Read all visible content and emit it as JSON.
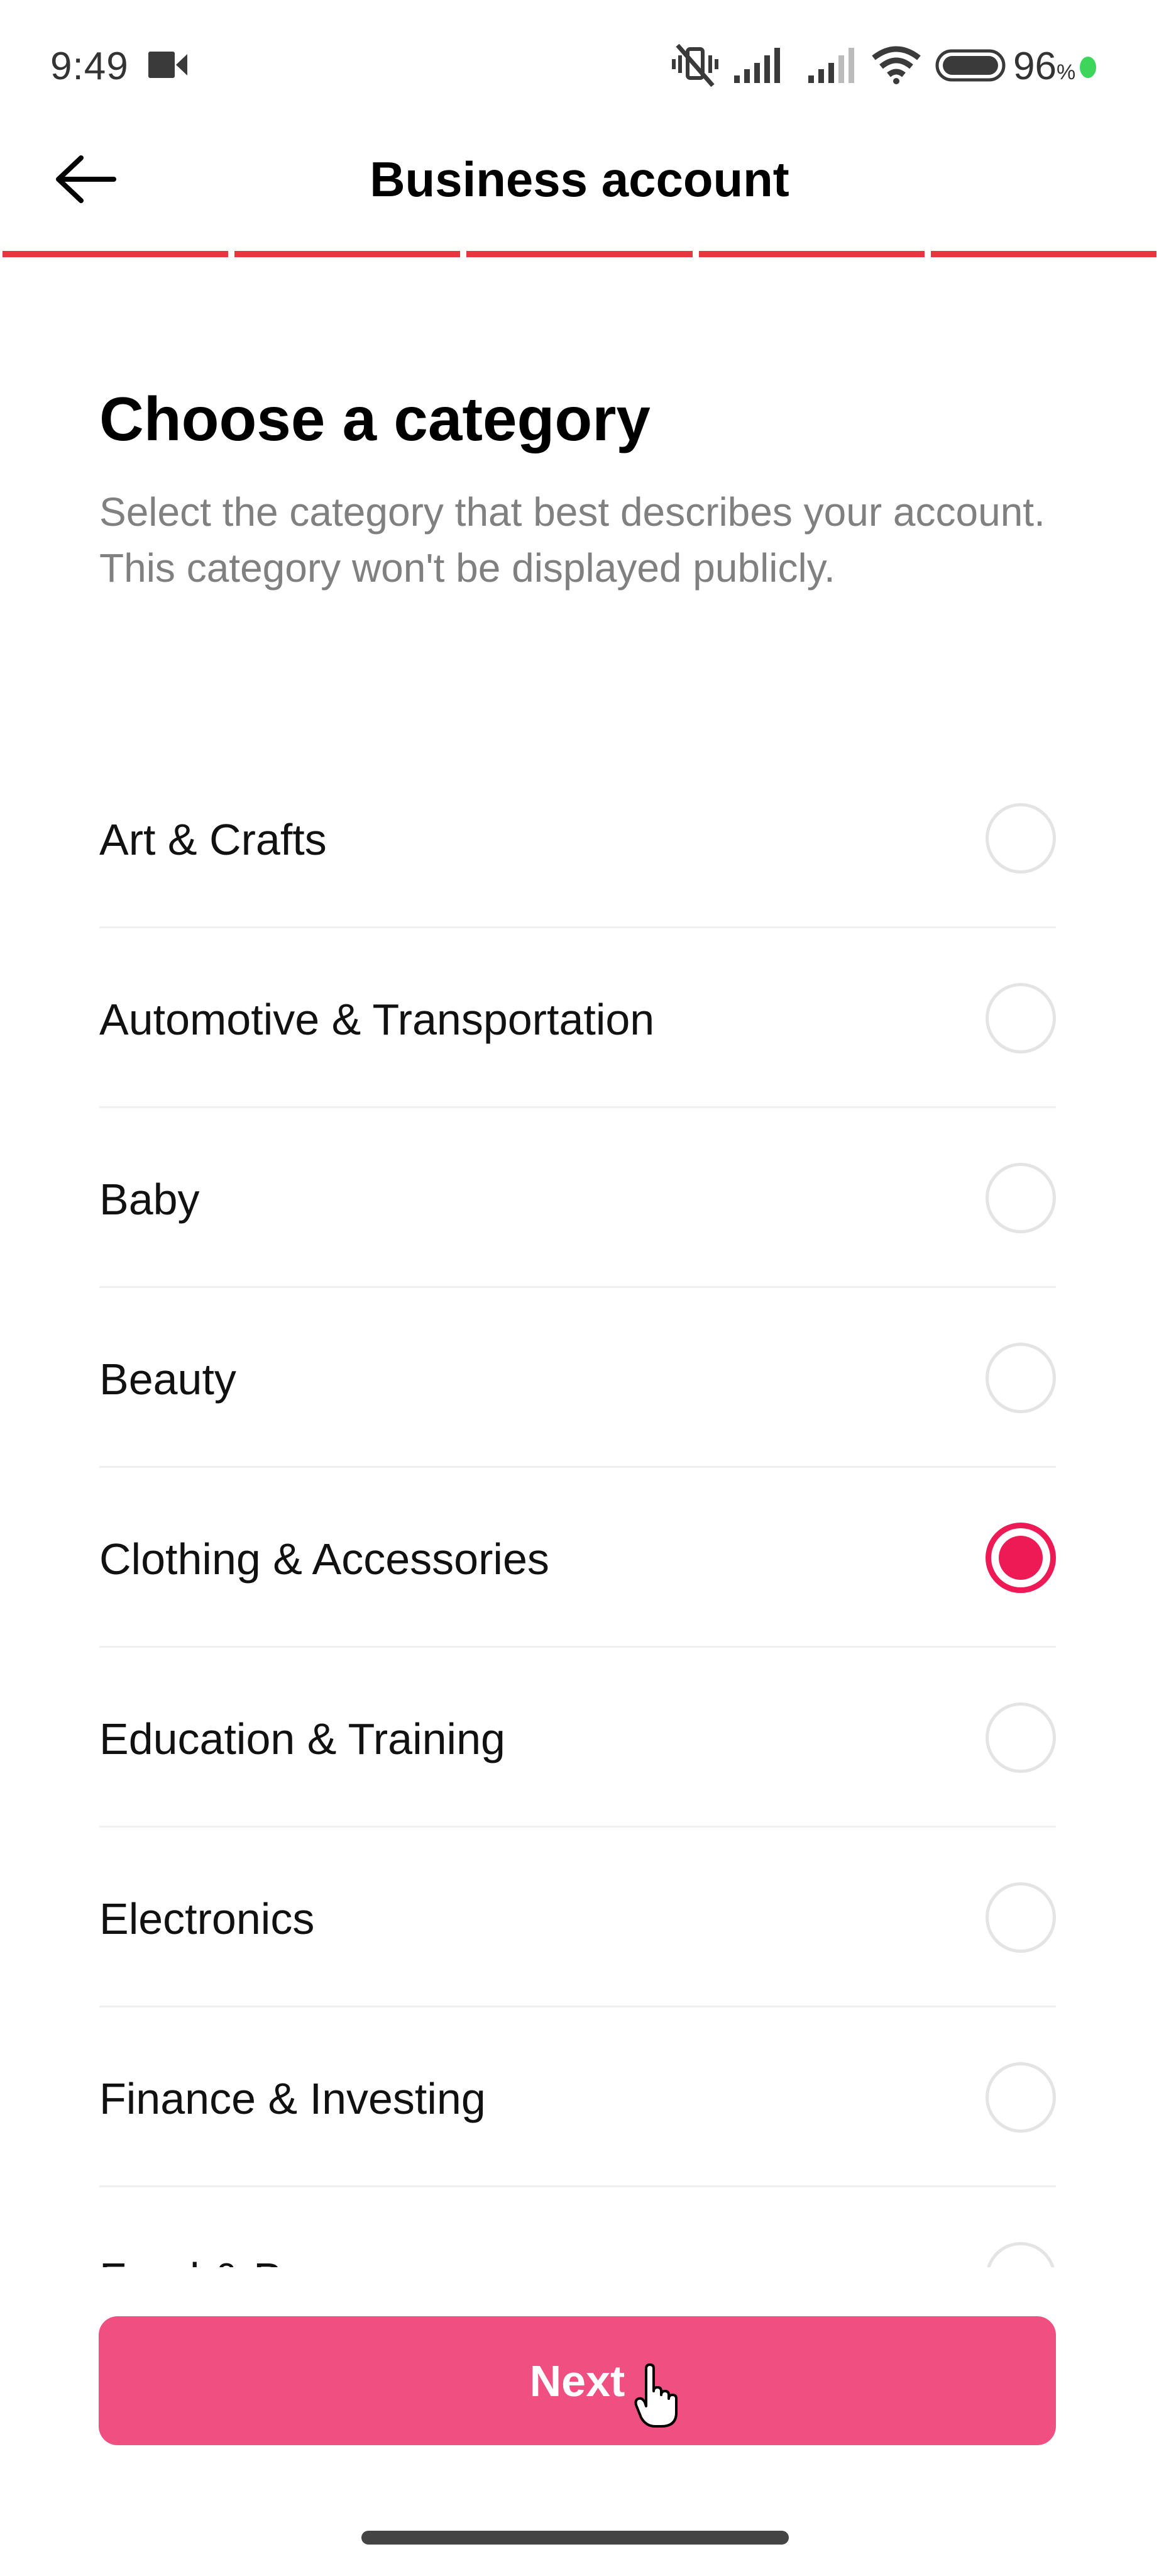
{
  "status_bar": {
    "time": "9:49",
    "icons": [
      "video-record-icon",
      "vibrate-mute-icon",
      "signal-sim1-icon",
      "signal-sim2-icon",
      "wifi-icon",
      "battery-icon"
    ],
    "battery_percent": "96",
    "battery_suffix": "%",
    "status_dot_color": "#3ed65a"
  },
  "header": {
    "back_icon": "arrow-left-icon",
    "title": "Business account"
  },
  "progress": {
    "steps_total": 5,
    "steps_completed": 5,
    "color": "#e8363f"
  },
  "main": {
    "heading": "Choose a category",
    "description": "Select the category that best describes your account. This category won't be displayed publicly.",
    "categories": [
      {
        "label": "Art & Crafts",
        "selected": false
      },
      {
        "label": "Automotive & Transportation",
        "selected": false
      },
      {
        "label": "Baby",
        "selected": false
      },
      {
        "label": "Beauty",
        "selected": false
      },
      {
        "label": "Clothing & Accessories",
        "selected": true
      },
      {
        "label": "Education & Training",
        "selected": false
      },
      {
        "label": "Electronics",
        "selected": false
      },
      {
        "label": "Finance & Investing",
        "selected": false
      },
      {
        "label": "Food & Beverage",
        "selected": false
      }
    ],
    "selected_value": "Clothing & Accessories"
  },
  "footer": {
    "next_label": "Next",
    "next_color": "#ef4f81",
    "accent_color": "#ed1a56"
  }
}
